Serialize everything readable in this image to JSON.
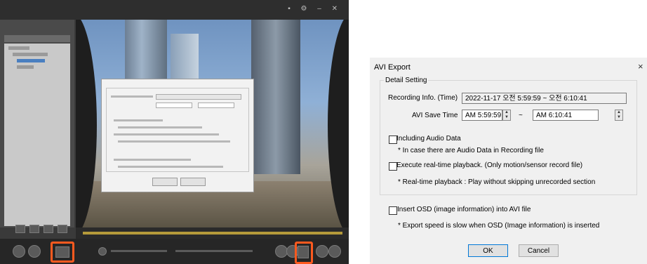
{
  "dialog": {
    "title": "AVI Export",
    "close_symbol": "×",
    "group_label": "Detail Setting",
    "recording_info_label": "Recording Info. (Time)",
    "recording_info_value": "2022-11-17 오전 5:59:59 ~ 오전 6:10:41",
    "save_time_label": "AVI Save Time",
    "start_time": "AM  5:59:59",
    "range_sep": "~",
    "end_time": "AM  6:10:41",
    "audio_checkbox_label": "Including Audio Data",
    "audio_note": "* In case there are Audio Data in Recording file",
    "realtime_checkbox_label": "Execute real-time playback. (Only motion/sensor record file)",
    "realtime_note": "* Real-time playback : Play without skipping unrecorded section",
    "osd_checkbox_label": "Insert OSD (image information) into AVI file",
    "osd_note": "* Export speed is slow when OSD (Image information) is inserted",
    "ok_label": "OK",
    "cancel_label": "Cancel"
  },
  "icons": {
    "spin": "spin-up-down-icon",
    "close": "close-icon",
    "export": "export-icon"
  },
  "colors": {
    "highlight": "#ff5a1f",
    "default_button_border": "#0078d7"
  }
}
